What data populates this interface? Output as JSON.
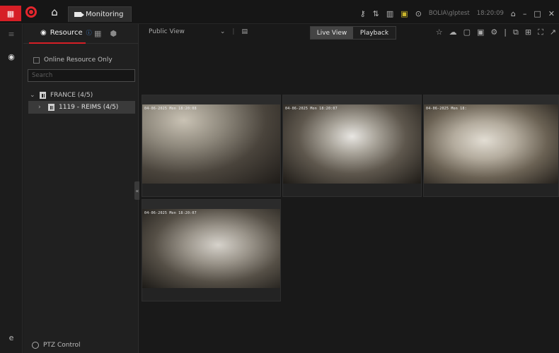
{
  "titlebar": {
    "tab_label": "Monitoring",
    "user": "BOLIA\\glptest",
    "time": "18:20:09",
    "accent": "#d61f26"
  },
  "panel": {
    "tab_resource": "Resource",
    "online_only": "Online Resource Only",
    "search_placeholder": "Search",
    "tree": [
      {
        "label": "FRANCE (4/5)",
        "expanded": true
      },
      {
        "label": "1119 - REIMS (4/5)",
        "expanded": false,
        "selected": true
      }
    ],
    "ptz_label": "PTZ Control"
  },
  "main": {
    "view_name": "Public View",
    "live_view": "Live View",
    "playback": "Playback",
    "tiles": [
      {
        "osd": "04-06-2025 Mon 18:20:08"
      },
      {
        "osd": "04-06-2025 Mon 18:20:07"
      },
      {
        "osd": "04-06-2025 Mon 18:"
      },
      {
        "osd": "04-06-2025 Mon 18:20:07"
      }
    ]
  },
  "icons": [
    "app-grid-icon",
    "brand-logo-icon",
    "home-icon",
    "camera-icon",
    "key-icon",
    "transfer-icon",
    "layout-icon",
    "image-icon",
    "help-icon",
    "lock-icon",
    "minimize-icon",
    "maximize-icon",
    "close-icon",
    "globe-icon",
    "info-icon",
    "star-icon",
    "cloud-icon"
  ]
}
